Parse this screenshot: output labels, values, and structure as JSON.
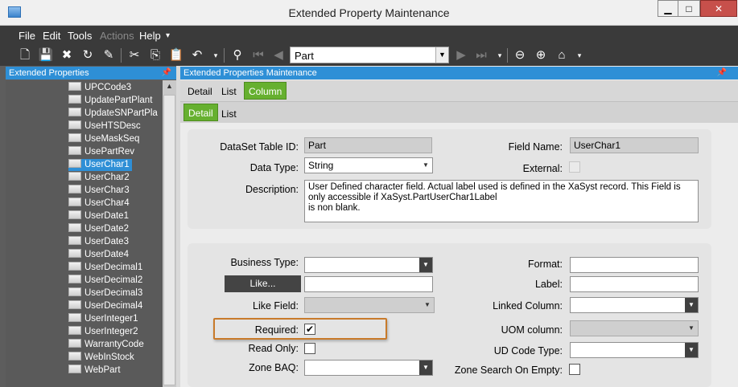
{
  "window": {
    "title": "Extended Property Maintenance",
    "min_glyph": "▁",
    "max_glyph": "□",
    "close_glyph": "✕"
  },
  "menu": {
    "items": [
      "File",
      "Edit",
      "Tools",
      "Actions",
      "Help"
    ],
    "help_arrow": "▾",
    "disabled": [
      "Actions"
    ]
  },
  "toolbar": {
    "search_value": "Part",
    "icons": [
      "new-icon",
      "save-icon",
      "delete-icon",
      "refresh-icon",
      "clear-icon",
      "cut-icon",
      "copy-icon",
      "paste-icon",
      "undo-icon",
      "search-binoculars-icon",
      "first-record-icon",
      "previous-record-icon",
      "next-record-icon",
      "last-record-icon",
      "back-icon",
      "forward-icon",
      "home-icon"
    ]
  },
  "left_panel": {
    "header": "Extended Properties",
    "items": [
      "UPCCode3",
      "UpdatePartPlant",
      "UpdateSNPartPla",
      "UseHTSDesc",
      "UseMaskSeq",
      "UsePartRev",
      "UserChar1",
      "UserChar2",
      "UserChar3",
      "UserChar4",
      "UserDate1",
      "UserDate2",
      "UserDate3",
      "UserDate4",
      "UserDecimal1",
      "UserDecimal2",
      "UserDecimal3",
      "UserDecimal4",
      "UserInteger1",
      "UserInteger2",
      "WarrantyCode",
      "WebInStock",
      "WebPart"
    ],
    "selected": "UserChar1"
  },
  "right_panel": {
    "header": "Extended Properties Maintenance",
    "tabs_top": [
      "Detail",
      "List",
      "Column"
    ],
    "active_top": "Column",
    "tabs_sub": [
      "Detail",
      "List"
    ],
    "active_sub": "Detail"
  },
  "form": {
    "dataset_label": "DataSet Table ID:",
    "dataset_value": "Part",
    "field_name_label": "Field Name:",
    "field_name_value": "UserChar1",
    "data_type_label": "Data Type:",
    "data_type_value": "String",
    "external_label": "External:",
    "description_label": "Description:",
    "description_value": "User Defined character field. Actual label used is defined in the XaSyst record. This Field is only accessible if XaSyst.PartUserChar1Label\nis non blank.",
    "business_type_label": "Business Type:",
    "like_button": "Like...",
    "like_field_label": "Like Field:",
    "required_label": "Required:",
    "required_checked": true,
    "required_check_glyph": "✔",
    "read_only_label": "Read Only:",
    "zone_baq_label": "Zone BAQ:",
    "format_label": "Format:",
    "label_label": "Label:",
    "linked_column_label": "Linked Column:",
    "uom_column_label": "UOM column:",
    "ud_code_type_label": "UD Code Type:",
    "zone_search_label": "Zone Search On Empty:",
    "dropdown_glyph": "▼"
  },
  "colors": {
    "accent_blue": "#2e8fd6",
    "active_tab_green": "#66b02f",
    "highlight_orange": "#c87a2a",
    "toolbar_dark": "#3a3a3a"
  }
}
